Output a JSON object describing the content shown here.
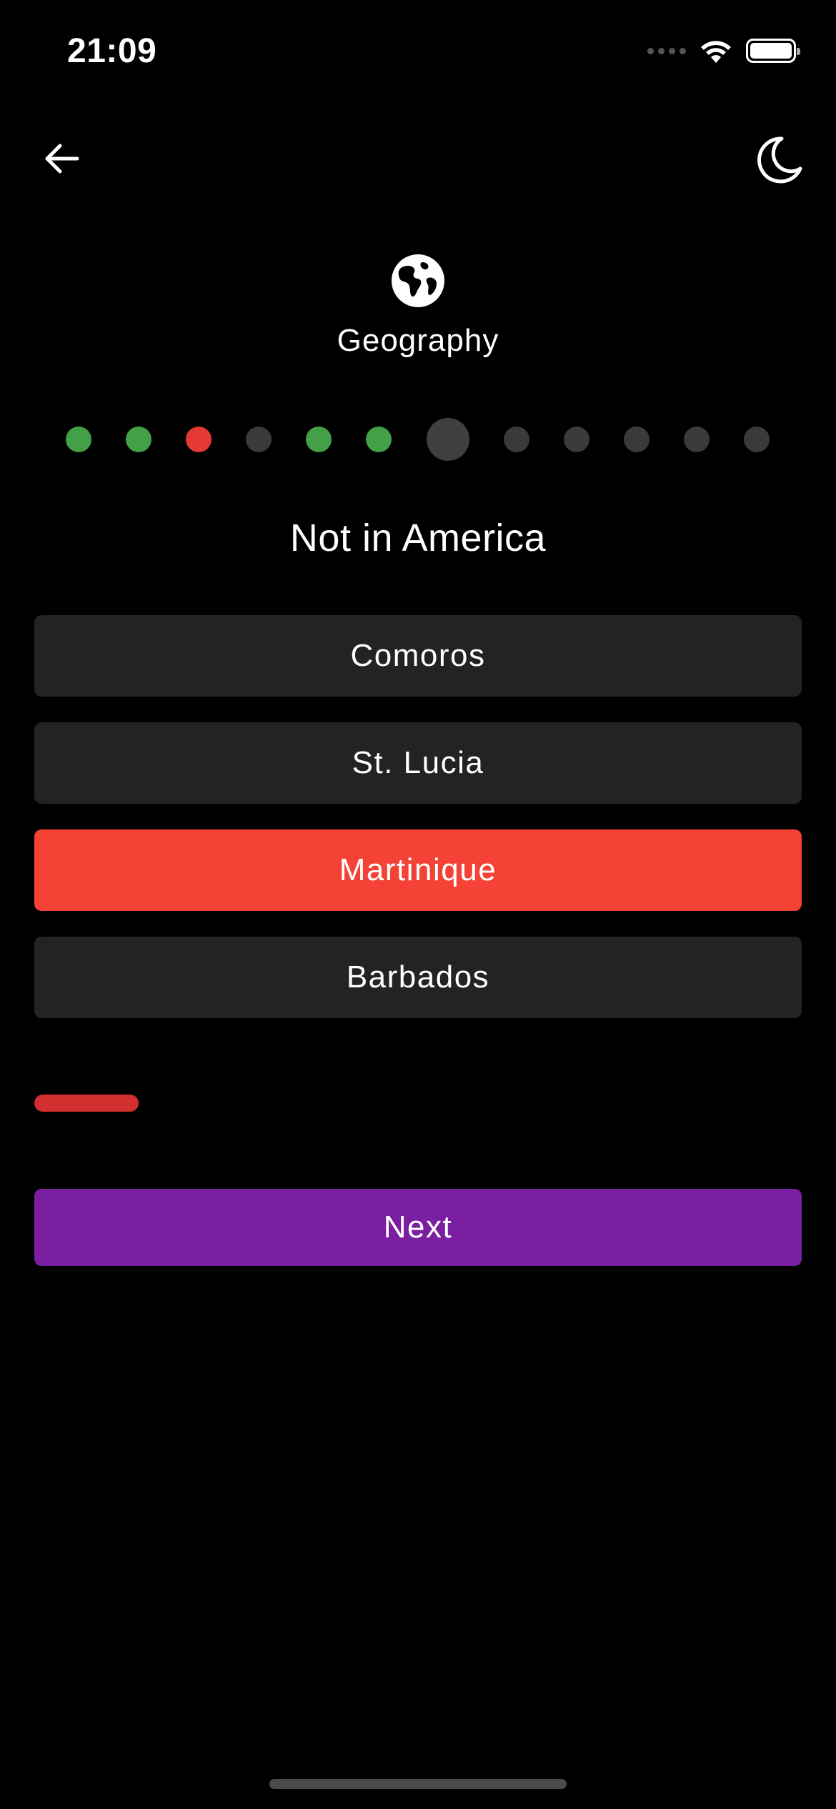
{
  "status_bar": {
    "time": "21:09"
  },
  "category": {
    "title": "Geography",
    "icon": "globe-icon"
  },
  "progress": {
    "current_index": 6,
    "states": [
      "correct",
      "correct",
      "wrong",
      "unanswered",
      "correct",
      "correct",
      "current",
      "unanswered",
      "unanswered",
      "unanswered",
      "unanswered",
      "unanswered"
    ],
    "colors": {
      "correct": "#43a047",
      "wrong": "#e53935",
      "unanswered": "#3a3a3a",
      "current": "#3f3f3f"
    }
  },
  "question": {
    "text": "Not in America"
  },
  "options": [
    {
      "label": "Comoros",
      "state": "default"
    },
    {
      "label": "St. Lucia",
      "state": "default"
    },
    {
      "label": "Martinique",
      "state": "wrong"
    },
    {
      "label": "Barbados",
      "state": "default"
    }
  ],
  "timer": {
    "remaining_fraction": 0.136,
    "color": "#d32f2f"
  },
  "next_button": {
    "label": "Next",
    "color": "#7b1fa2"
  },
  "colors": {
    "background": "#000000",
    "option_bg": "#232323",
    "wrong": "#f44336"
  }
}
